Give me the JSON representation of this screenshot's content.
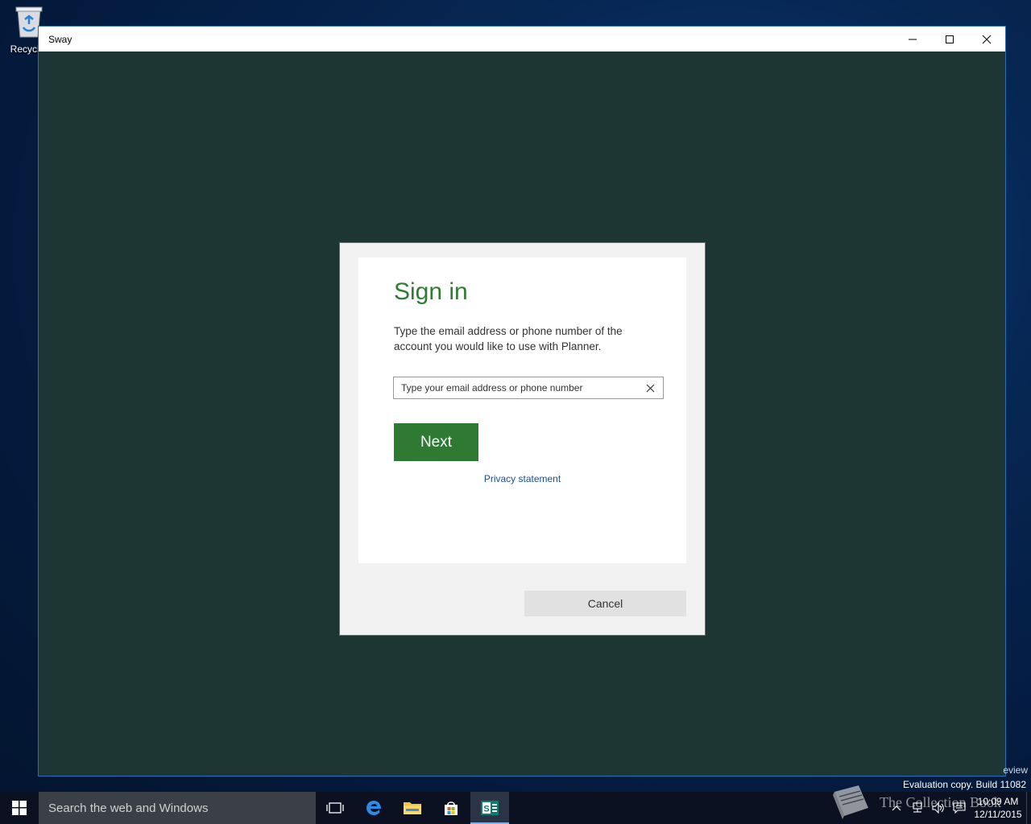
{
  "desktop": {
    "recycle_label": "Recycle"
  },
  "window": {
    "title": "Sway"
  },
  "dialog": {
    "heading": "Sign in",
    "description": "Type the email address or phone number of the account you would like to use with Planner.",
    "email_placeholder": "Type your email address or phone number",
    "email_value": "",
    "next_label": "Next",
    "privacy_label": "Privacy statement",
    "cancel_label": "Cancel"
  },
  "system": {
    "preview_text": "eview",
    "eval_text": "Evaluation copy. Build 11082",
    "search_placeholder": "Search the web and Windows",
    "time": "10:09 AM",
    "date": "12/11/2015",
    "watermark_text": "The Collection Book"
  },
  "colors": {
    "accent_green": "#2e7a32",
    "app_background": "#1d3533",
    "link_blue": "#1a4f9c"
  }
}
